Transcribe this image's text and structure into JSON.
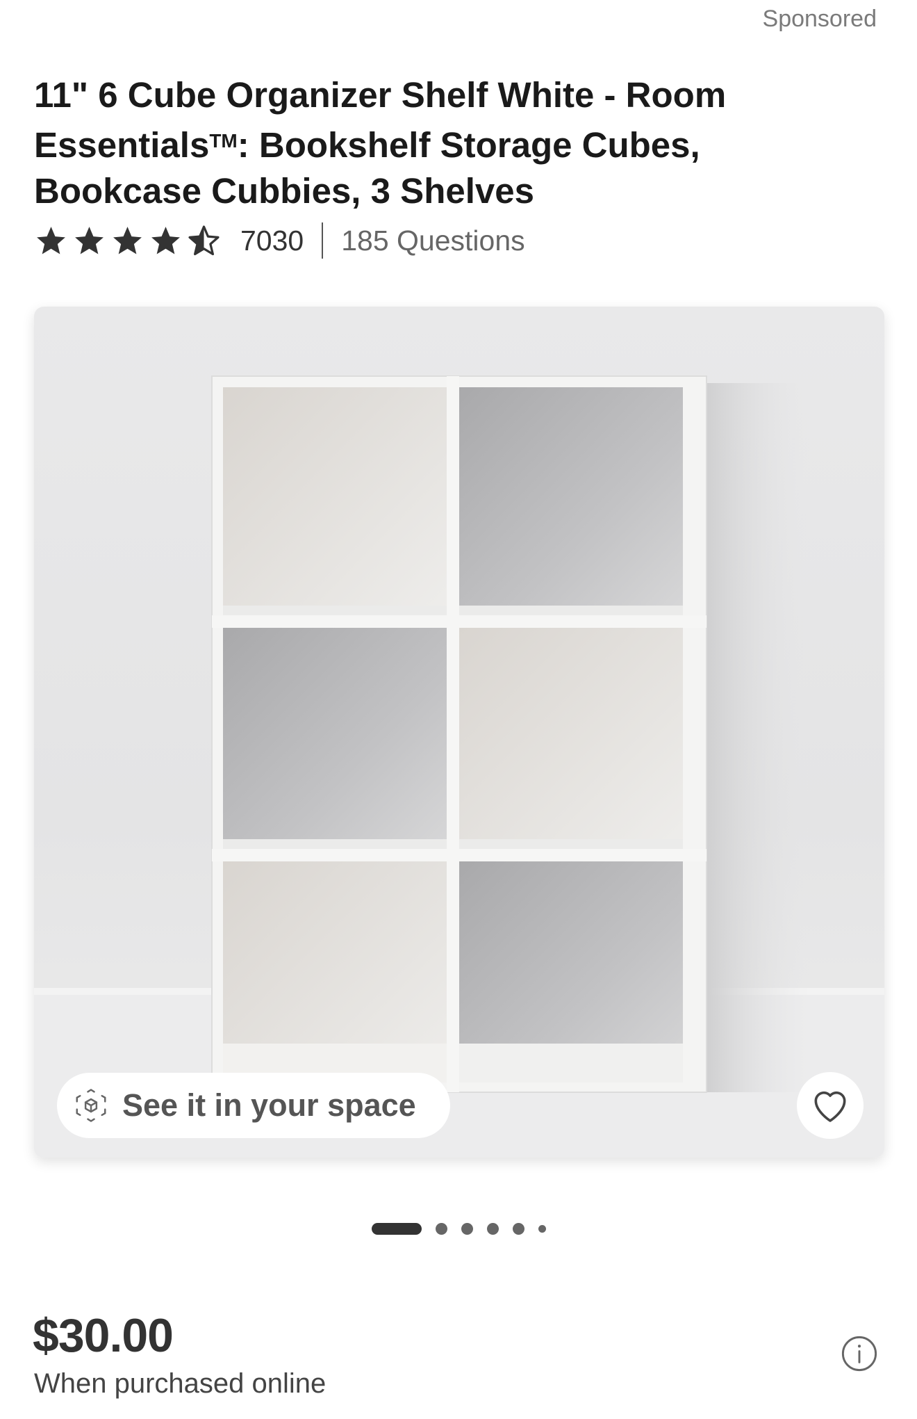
{
  "sponsored_label": "Sponsored",
  "product": {
    "title_main": "11\" 6 Cube Organizer Shelf White - Room Essentials",
    "title_tm": "TM",
    "title_rest": ": Bookshelf Storage Cubes, Bookcase Cubbies, 3 Shelves",
    "rating": 4.5,
    "rating_count": "7030",
    "questions": "185 Questions"
  },
  "gallery": {
    "ar_label": "See it in your space",
    "ar_icon": "ar-cube-icon",
    "favorite_icon": "heart-icon",
    "slide_count": 6,
    "active_slide": 0
  },
  "pricing": {
    "price": "$30.00",
    "note": "When purchased online",
    "info_icon": "info-icon"
  },
  "colors": {
    "text_primary": "#1a1a1a",
    "text_secondary": "#7a7a7a",
    "background": "#ffffff"
  }
}
